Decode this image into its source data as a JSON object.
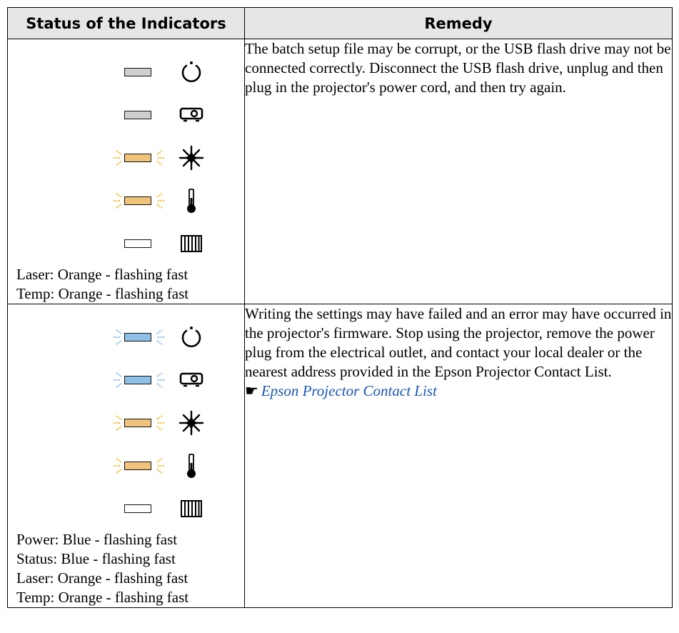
{
  "table": {
    "headers": {
      "status": "Status of the Indicators",
      "remedy": "Remedy"
    },
    "rows": [
      {
        "indicators": [
          {
            "name": "power",
            "state": "off",
            "lamp_color": "#cfcfcf",
            "icon": "power-icon"
          },
          {
            "name": "status",
            "state": "off",
            "lamp_color": "#cfcfcf",
            "icon": "projector-icon"
          },
          {
            "name": "laser",
            "state": "flashing",
            "lamp_color": "#f0c27a",
            "icon": "laser-icon"
          },
          {
            "name": "temp",
            "state": "flashing",
            "lamp_color": "#f0c27a",
            "icon": "thermometer-icon"
          },
          {
            "name": "filter",
            "state": "off",
            "lamp_color": "#ffffff",
            "icon": "filter-icon"
          }
        ],
        "status_lines": [
          "Laser: Orange - flashing fast",
          "Temp: Orange - flashing fast"
        ],
        "remedy": "The batch setup file may be corrupt, or the USB flash drive may not be connected correctly. Disconnect the USB flash drive, unplug and then plug in the projector's power cord, and then try again."
      },
      {
        "indicators": [
          {
            "name": "power",
            "state": "flashing",
            "lamp_color": "#8ec0e8",
            "icon": "power-icon"
          },
          {
            "name": "status",
            "state": "flashing",
            "lamp_color": "#8ec0e8",
            "icon": "projector-icon"
          },
          {
            "name": "laser",
            "state": "flashing",
            "lamp_color": "#f0c27a",
            "icon": "laser-icon"
          },
          {
            "name": "temp",
            "state": "flashing",
            "lamp_color": "#f0c27a",
            "icon": "thermometer-icon"
          },
          {
            "name": "filter",
            "state": "off",
            "lamp_color": "#ffffff",
            "icon": "filter-icon"
          }
        ],
        "status_lines": [
          "Power: Blue - flashing fast",
          "Status: Blue - flashing fast",
          "Laser: Orange - flashing fast",
          "Temp: Orange - flashing fast"
        ],
        "remedy": "Writing the settings may have failed and an error may have occurred in the projector's firmware. Stop using the projector, remove the power plug from the electrical outlet, and contact your local dealer or the nearest address provided in the Epson Projector Contact List.",
        "link": {
          "icon": "pointing-hand-icon",
          "text": "Epson Projector Contact List"
        }
      }
    ]
  },
  "colors": {
    "ray_orange": "#f2b71c",
    "ray_blue": "#7fb7e0",
    "link": "#1a56b5",
    "header_bg": "#e6e6e6"
  }
}
